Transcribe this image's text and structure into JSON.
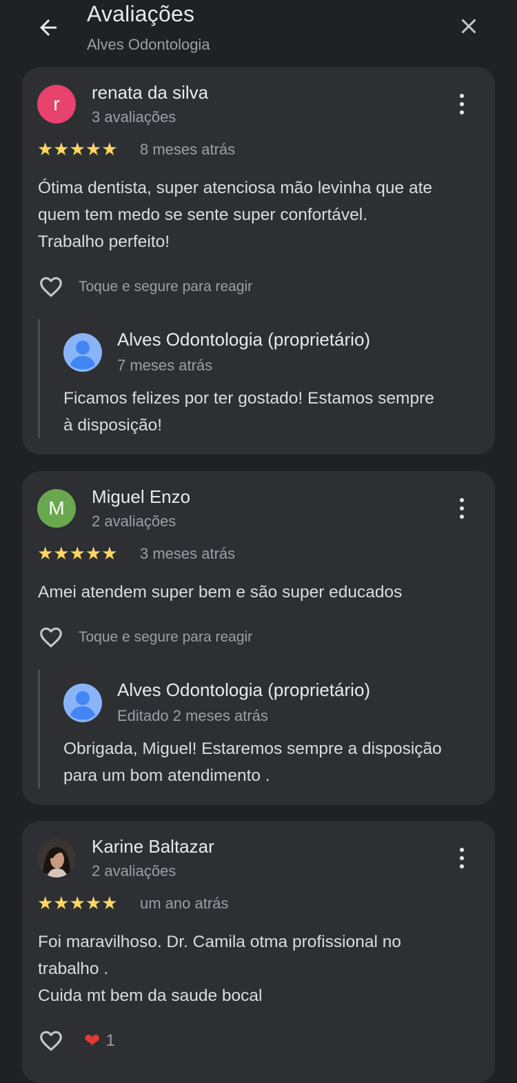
{
  "header": {
    "title": "Avaliações",
    "subtitle": "Alves Odontologia",
    "icons": {
      "back": "arrow-back-icon",
      "close": "close-icon"
    }
  },
  "colors": {
    "background": "#202124",
    "card": "#2d2f33",
    "star": "#fdd663",
    "avatar_r": "#e8436d",
    "avatar_m": "#6aa84f",
    "owner_avatar": "#8ab4f8",
    "heart_filled": "#e53935"
  },
  "reviews": [
    {
      "avatar_letter": "r",
      "name": "renata da silva",
      "review_count": "3 avaliações",
      "stars": "★★★★★",
      "rating": 5,
      "date": "8 meses atrás",
      "text_lines": [
        "Ótima dentista, super atenciosa mão levinha que ate",
        "quem tem medo se sente super confortável.",
        "Trabalho perfeito!"
      ],
      "react_label": "Toque e segure para reagir",
      "owner_reply": {
        "name": "Alves Odontologia (proprietário)",
        "date": "7 meses atrás",
        "text_lines": [
          "Ficamos felizes por ter gostado! Estamos sempre",
          "à disposição!"
        ]
      }
    },
    {
      "avatar_letter": "M",
      "name": "Miguel Enzo",
      "review_count": "2 avaliações",
      "stars": "★★★★★",
      "rating": 5,
      "date": "3 meses atrás",
      "text_lines": [
        "Amei atendem super bem e são super educados"
      ],
      "react_label": "Toque e segure para reagir",
      "owner_reply": {
        "name": "Alves Odontologia (proprietário)",
        "date": "Editado 2 meses atrás",
        "text_lines": [
          "Obrigada, Miguel! Estaremos sempre a disposição",
          "para um bom atendimento ."
        ]
      }
    },
    {
      "avatar_letter": "",
      "name": "Karine Baltazar",
      "review_count": "2 avaliações",
      "stars": "★★★★★",
      "rating": 5,
      "date": "um ano atrás",
      "text_lines": [
        "Foi maravilhoso. Dr. Camila otma profissional no",
        "trabalho .",
        "Cuida mt bem da saude bocal"
      ],
      "reaction": {
        "emoji": "❤",
        "count": "1"
      }
    }
  ]
}
